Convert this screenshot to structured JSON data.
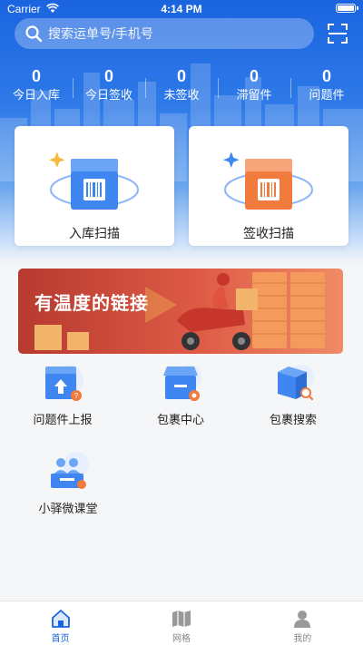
{
  "status_bar": {
    "carrier": "Carrier",
    "time": "4:14 PM"
  },
  "search": {
    "placeholder": "搜索运单号/手机号"
  },
  "stats": [
    {
      "value": "0",
      "label": "今日入库"
    },
    {
      "value": "0",
      "label": "今日签收"
    },
    {
      "value": "0",
      "label": "未签收"
    },
    {
      "value": "0",
      "label": "滞留件"
    },
    {
      "value": "0",
      "label": "问题件"
    }
  ],
  "cards": [
    {
      "label": "入库扫描"
    },
    {
      "label": "签收扫描"
    }
  ],
  "banner": {
    "slogan": "有温度的链接"
  },
  "grid": [
    {
      "label": "问题件上报",
      "icon": "problem-report-icon"
    },
    {
      "label": "包裹中心",
      "icon": "parcel-center-icon"
    },
    {
      "label": "包裹搜索",
      "icon": "parcel-search-icon"
    },
    {
      "label": "小驿微课堂",
      "icon": "micro-classroom-icon"
    }
  ],
  "tabs": [
    {
      "label": "首页",
      "icon": "home-icon",
      "active": true
    },
    {
      "label": "网格",
      "icon": "grid-map-icon",
      "active": false
    },
    {
      "label": "我的",
      "icon": "profile-icon",
      "active": false
    }
  ],
  "colors": {
    "primary": "#1a64e0",
    "scan_in": "#3f86f0",
    "scan_out": "#f07b3c",
    "banner": "#d9503e"
  }
}
